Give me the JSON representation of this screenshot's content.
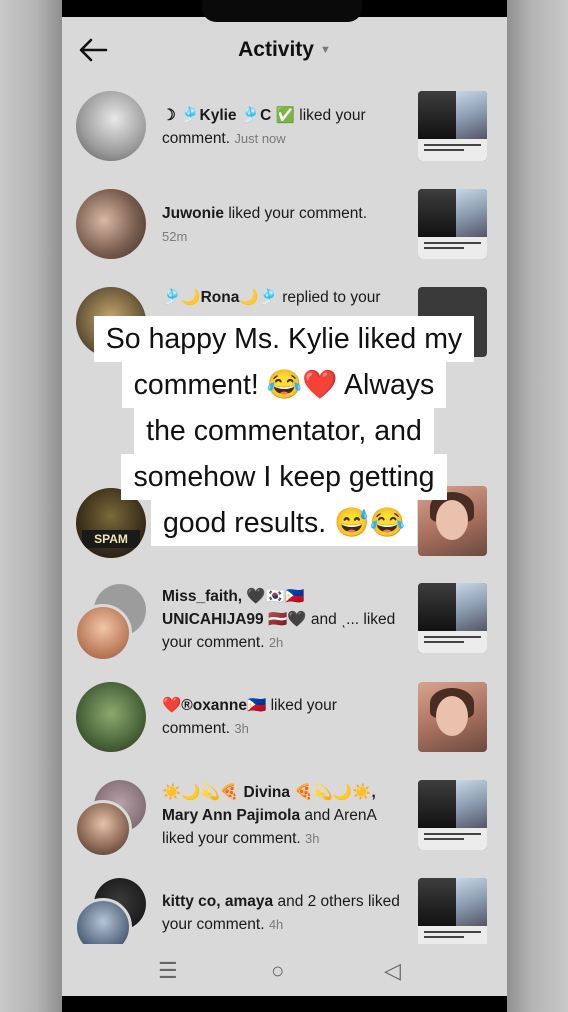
{
  "header": {
    "title": "Activity",
    "back_icon": "arrow-left-icon"
  },
  "notifications": [
    {
      "user": "☽ 🎐Kylie 🎐C ✅",
      "action": " liked your comment.",
      "time": "Just now",
      "avatar_color": "#bcbcbc"
    },
    {
      "user": "Juwonie",
      "action": " liked your comment.",
      "time": "52m",
      "avatar_color": "#8a7466"
    },
    {
      "user": "🎐🌙Rona🌙🎐",
      "action": " replied to your",
      "time": "",
      "avatar_color": "#6b5a3a"
    },
    {
      "user": "",
      "action": "",
      "time": "",
      "avatar_label": "SPAM",
      "avatar_color": "#2b2b2b"
    },
    {
      "user": "Miss_faith, 🖤🇰🇷🇵🇭 UNICAHIJA99 🇱🇻🖤",
      "action": " and ͺ... liked your comment.",
      "time": "2h",
      "avatar_color": "#c99a7a"
    },
    {
      "user": "❤️®oxanne🇵🇭",
      "action": " liked your comment.",
      "time": "3h",
      "avatar_color": "#4f6a3e"
    },
    {
      "user": "☀️🌙💫🍕 Divina 🍕💫🌙☀️, Mary Ann Pajimola",
      "action": " and ArenA liked your comment.",
      "time": "3h",
      "avatar_color": "#8e8e8e"
    },
    {
      "user": "kitty co, amaya",
      "action": " and 2 others liked your comment.",
      "time": "4h",
      "avatar_color": "#5c6f86"
    }
  ],
  "caption": {
    "lines": [
      "So happy Ms. Kylie liked my",
      "comment! 😂❤️ Always",
      "the commentator, and",
      "somehow I keep getting",
      "good results. 😅😂"
    ]
  },
  "navbar": {
    "menu_icon": "☰",
    "home_icon": "○",
    "back_icon": "◁"
  },
  "colors": {
    "screen_bg": "#d9d9d9",
    "caption_bg": "#ffffff"
  }
}
